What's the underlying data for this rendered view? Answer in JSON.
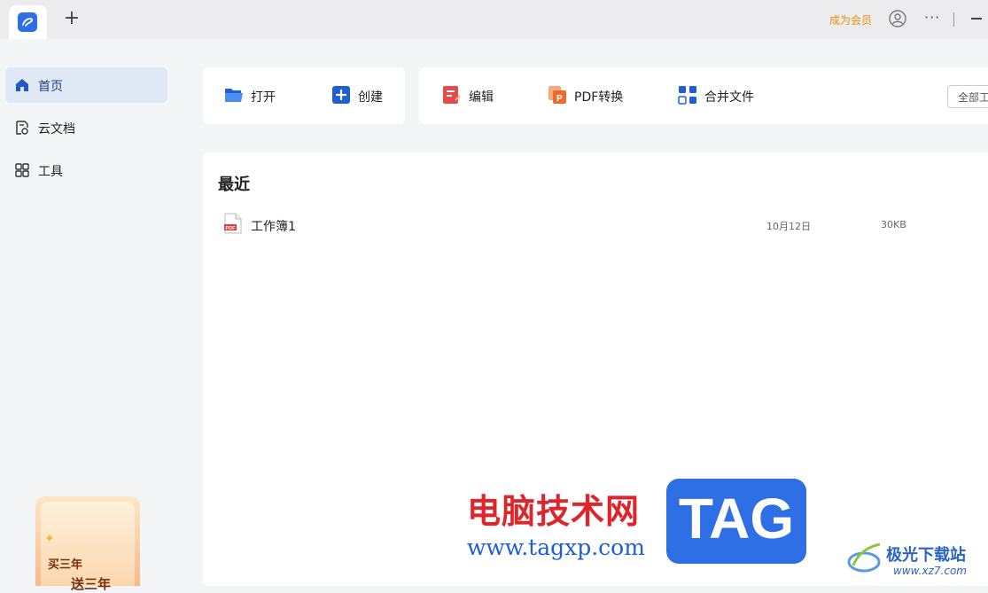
{
  "titlebar": {
    "new_tab_symbol": "+",
    "vip_label": "成为会员",
    "more_symbol": "···"
  },
  "sidebar": {
    "items": [
      {
        "label": "首页",
        "icon": "home-icon",
        "active": true
      },
      {
        "label": "云文档",
        "icon": "cloud-doc-icon",
        "active": false
      },
      {
        "label": "工具",
        "icon": "grid-tools-icon",
        "active": false
      }
    ],
    "promo": {
      "line1": "买三年",
      "line2": "送三年"
    }
  },
  "actions": {
    "open": "打开",
    "create": "创建",
    "edit": "编辑",
    "pdf_convert": "PDF转换",
    "merge": "合并文件",
    "filter": "全部工具"
  },
  "recent": {
    "title": "最近",
    "files": [
      {
        "name": "工作簿1",
        "date": "10月12日",
        "size": "30KB",
        "icon": "pdf-file-icon"
      }
    ]
  },
  "watermark": {
    "site_cn": "电脑技术网",
    "site_url": "www.tagxp.com",
    "tag": "TAG",
    "site2_cn": "极光下载站",
    "site2_url": "www.xz7.com"
  },
  "colors": {
    "accent": "#2f6fe6",
    "vip": "#e6910e",
    "active_nav_bg": "#e0e8f6"
  }
}
